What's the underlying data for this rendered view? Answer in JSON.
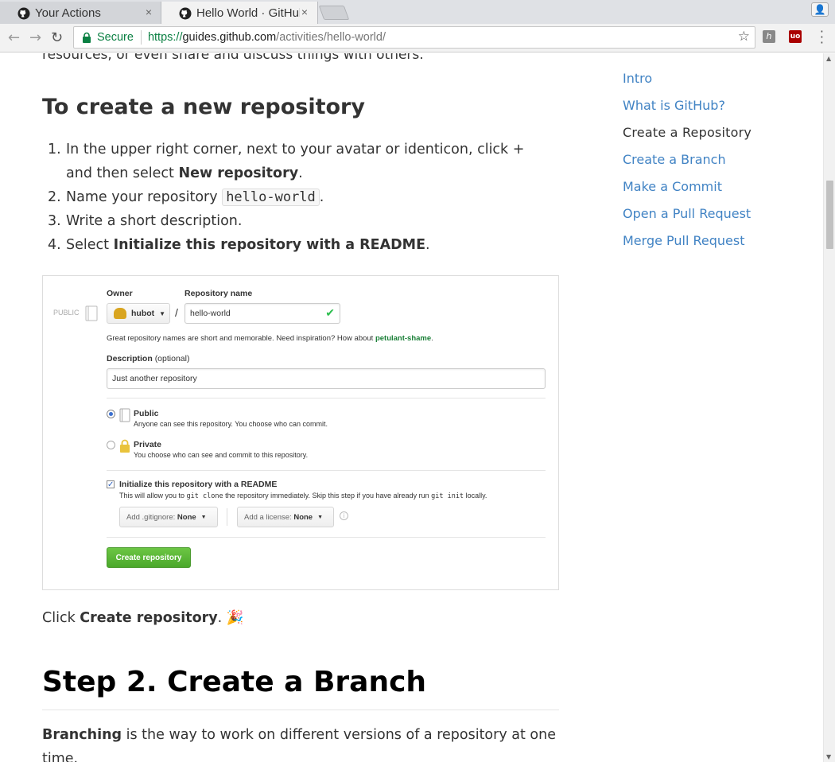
{
  "browser": {
    "tabs": [
      {
        "title": "Your Actions",
        "close": "×"
      },
      {
        "title": "Hello World · GitHub",
        "close": "×"
      }
    ],
    "secure_label": "Secure",
    "url": {
      "scheme": "https://",
      "host": "guides.github.com",
      "path": "/activities/hello-world/"
    },
    "extension_badge": "1"
  },
  "article": {
    "intro_tail": "resources, or even share and discuss things with others.",
    "section_heading": "To create a new repository",
    "steps": [
      {
        "num": "1.",
        "before": "In the upper right corner, next to your avatar or identicon, click",
        "plus": "+",
        "mid": "and then select",
        "bold": "New repository",
        "after": "."
      },
      {
        "num": "2.",
        "before": "Name your repository",
        "code": "hello-world",
        "after": "."
      },
      {
        "num": "3.",
        "text": "Write a short description."
      },
      {
        "num": "4.",
        "before": "Select",
        "bold": "Initialize this repository with a README",
        "after": "."
      }
    ],
    "after_figure": {
      "before": "Click",
      "bold": "Create repository",
      "after": ".",
      "emoji": "🎉"
    },
    "step2_heading": "Step 2. Create a Branch",
    "branching": {
      "bold": "Branching",
      "rest": "is the way to work on different versions of a repository at one time."
    }
  },
  "figure": {
    "public_tag": "PUBLIC",
    "owner_label": "Owner",
    "repo_name_label": "Repository name",
    "owner_value": "hubot",
    "slash": "/",
    "repo_name_value": "hello-world",
    "hint_before": "Great repository names are short and memorable. Need inspiration? How about",
    "hint_suggestion": "petulant-shame",
    "hint_after": ".",
    "description_label": "Description",
    "description_optional": "(optional)",
    "description_value": "Just another repository",
    "public_title": "Public",
    "public_desc": "Anyone can see this repository. You choose who can commit.",
    "private_title": "Private",
    "private_desc": "You choose who can see and commit to this repository.",
    "init_label": "Initialize this repository with a README",
    "init_desc_1": "This will allow you to",
    "init_code_1": "git clone",
    "init_desc_2": "the repository immediately. Skip this step if you have already run",
    "init_code_2": "git init",
    "init_desc_3": "locally.",
    "gitignore_label": "Add .gitignore:",
    "gitignore_value": "None",
    "license_label": "Add a license:",
    "license_value": "None",
    "create_button": "Create repository"
  },
  "sidebar": {
    "items": [
      {
        "label": "Intro"
      },
      {
        "label": "What is GitHub?"
      },
      {
        "label": "Create a Repository"
      },
      {
        "label": "Create a Branch"
      },
      {
        "label": "Make a Commit"
      },
      {
        "label": "Open a Pull Request"
      },
      {
        "label": "Merge Pull Request"
      }
    ],
    "active_index": 2
  },
  "colors": {
    "link": "#4183c4",
    "secure": "#0b8043",
    "create_green": "#55a532"
  }
}
